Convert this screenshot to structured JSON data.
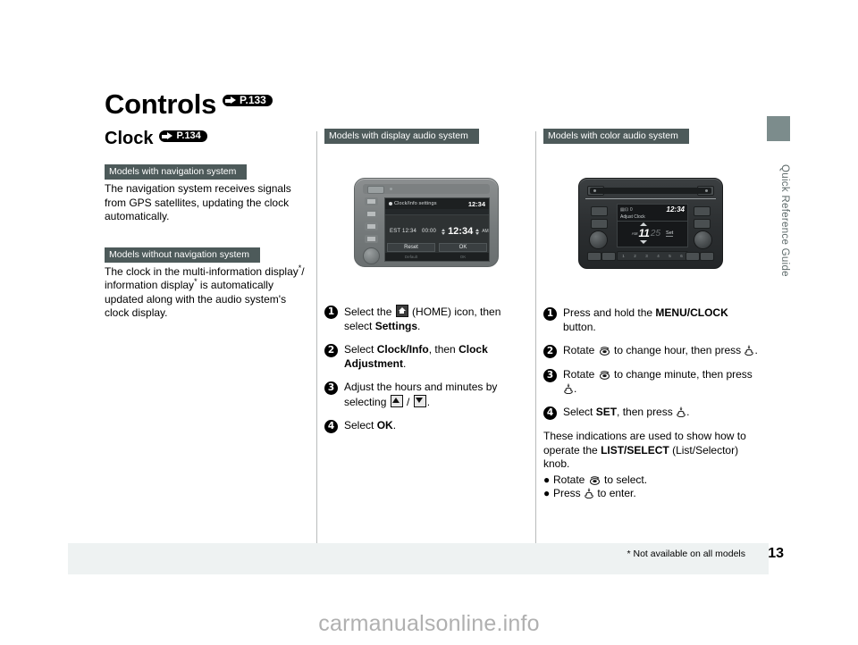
{
  "page": {
    "chapter_title": "Controls",
    "chapter_page_ref": "P.133",
    "section_title": "Clock",
    "section_page_ref": "P.134",
    "side_tab_label": "Quick Reference Guide",
    "footnote": "* Not available on all models",
    "page_number": "13",
    "watermark": "carmanualsonline.info"
  },
  "left_column": {
    "blocks": [
      {
        "banner": "Models with navigation system",
        "text": "The navigation system receives signals from GPS satellites, updating the clock automatically."
      },
      {
        "banner": "Models without navigation system",
        "text_part1": "The clock in the multi-information display",
        "text_part2": "/ information display",
        "text_part3": " is automatically updated along with the audio system's clock display.",
        "asterisk": "*"
      }
    ]
  },
  "middle_column": {
    "banner": "Models with display audio system",
    "device": {
      "name": "display-audio-head-unit",
      "screen_title": "Clock/Info settings",
      "screen_clock": "12:34",
      "timezone_label": "EST 12:34",
      "offset_label": "00:00",
      "big_clock": "12:34",
      "am_pm": "AM",
      "button_left": "Reset",
      "button_right": "OK",
      "foot_left": "Default",
      "foot_right": "OK"
    },
    "steps": [
      {
        "num": "1",
        "pre": "Select the ",
        "icon": "home-icon",
        "mid": " (HOME) icon, then select ",
        "bold": "Settings",
        "post": "."
      },
      {
        "num": "2",
        "pre": "Select ",
        "bold": "Clock/Info",
        "mid": ", then ",
        "bold2": "Clock Adjustment",
        "post": "."
      },
      {
        "num": "3",
        "pre": "Adjust the hours and minutes by selecting ",
        "mid": " / ",
        "post": "."
      },
      {
        "num": "4",
        "pre": "Select ",
        "bold": "OK",
        "post": "."
      }
    ]
  },
  "right_column": {
    "banner": "Models with color audio system",
    "device": {
      "name": "color-audio-head-unit",
      "screen_clock": "12:34",
      "screen_sub": "Adjust Clock",
      "am_label": "AM",
      "hour_value": "11",
      "minute_value": "25",
      "set_label": "Set",
      "presets": [
        "1",
        "2",
        "3",
        "4",
        "5",
        "6"
      ]
    },
    "steps": [
      {
        "num": "1",
        "pre": "Press and hold the ",
        "bold": "MENU/CLOCK",
        "post": " button."
      },
      {
        "num": "2",
        "pre": "Rotate ",
        "mid": " to change hour, then press ",
        "post": "."
      },
      {
        "num": "3",
        "pre": "Rotate ",
        "mid": " to change minute, then press ",
        "post": "."
      },
      {
        "num": "4",
        "pre": "Select ",
        "bold": "SET",
        "mid": ", then press ",
        "post": "."
      }
    ],
    "note": {
      "pre": "These indications are used to show how to operate the ",
      "bold": "LIST/SELECT",
      "post": " (List/Selector) knob.",
      "bullets": [
        {
          "pre": "Rotate ",
          "post": " to select."
        },
        {
          "pre": "Press ",
          "post": " to enter."
        }
      ]
    }
  },
  "colors": {
    "banner_bg": "#4d5a5a",
    "footer_band": "#eef2f2",
    "side_tab": "#7c8c8c",
    "divider": "#b9bcbc"
  }
}
